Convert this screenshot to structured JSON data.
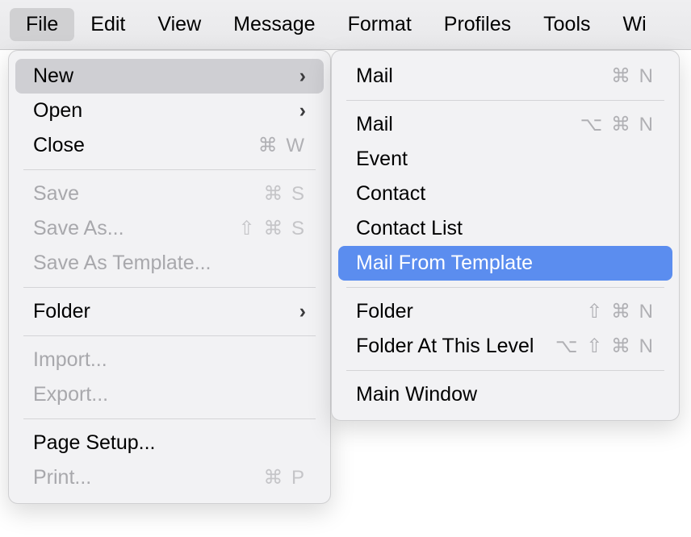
{
  "menubar": {
    "items": [
      {
        "label": "File"
      },
      {
        "label": "Edit"
      },
      {
        "label": "View"
      },
      {
        "label": "Message"
      },
      {
        "label": "Format"
      },
      {
        "label": "Profiles"
      },
      {
        "label": "Tools"
      },
      {
        "label": "Wi"
      }
    ]
  },
  "file_menu": {
    "new": "New",
    "open": "Open",
    "close": "Close",
    "close_sc": "⌘ W",
    "save": "Save",
    "save_sc": "⌘ S",
    "save_as": "Save As...",
    "save_as_sc": "⇧ ⌘ S",
    "save_as_template": "Save As Template...",
    "folder": "Folder",
    "import": "Import...",
    "export": "Export...",
    "page_setup": "Page Setup...",
    "print": "Print...",
    "print_sc": "⌘ P"
  },
  "new_submenu": {
    "mail1": "Mail",
    "mail1_sc": "⌘ N",
    "mail2": "Mail",
    "mail2_sc": "⌥ ⌘ N",
    "event": "Event",
    "contact": "Contact",
    "contact_list": "Contact List",
    "mail_from_template": "Mail From Template",
    "folder": "Folder",
    "folder_sc": "⇧ ⌘ N",
    "folder_at_level": "Folder At This Level",
    "folder_at_level_sc": "⌥ ⇧ ⌘ N",
    "main_window": "Main Window"
  }
}
